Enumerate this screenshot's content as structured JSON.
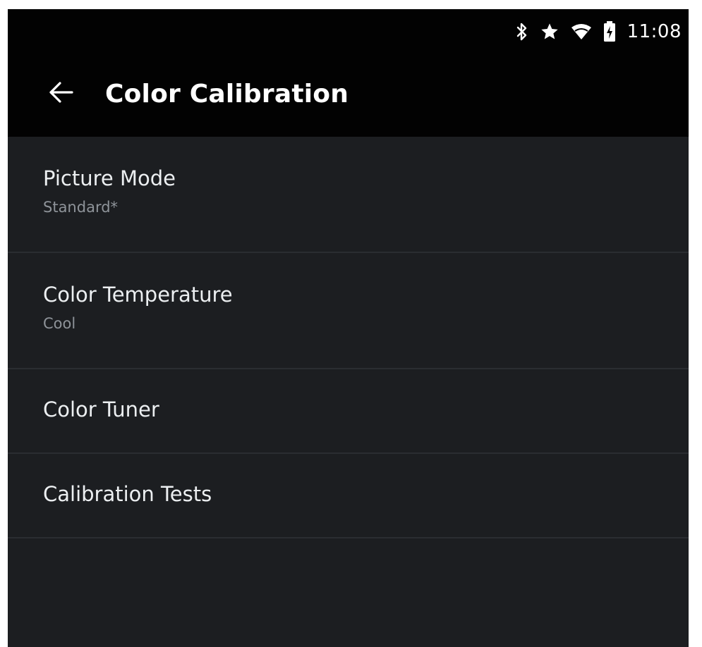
{
  "status_bar": {
    "time": "11:08",
    "icons": [
      "bluetooth-icon",
      "star-icon",
      "wifi-icon",
      "battery-charging-icon"
    ]
  },
  "app_bar": {
    "back_icon": "arrow-left-icon",
    "title": "Color Calibration"
  },
  "menu": {
    "items": [
      {
        "label": "Picture Mode",
        "value": "Standard*"
      },
      {
        "label": "Color Temperature",
        "value": "Cool"
      },
      {
        "label": "Color Tuner"
      },
      {
        "label": "Calibration Tests"
      }
    ]
  },
  "colors": {
    "app_bar_bg": "#020202",
    "list_bg": "#1c1e21",
    "primary_text": "#eceff1",
    "secondary_text": "#8e9399"
  }
}
